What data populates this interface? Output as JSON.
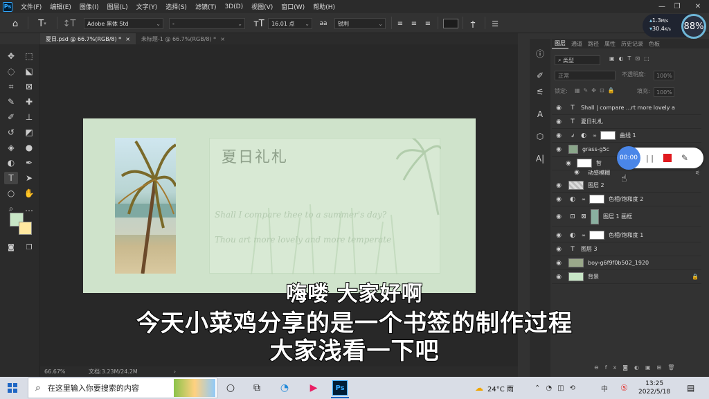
{
  "app": {
    "logo": "Ps",
    "menu": [
      "文件(F)",
      "编辑(E)",
      "图像(I)",
      "图层(L)",
      "文字(Y)",
      "选择(S)",
      "滤镜(T)",
      "3D(D)",
      "视图(V)",
      "窗口(W)",
      "帮助(H)"
    ]
  },
  "options": {
    "font_family": "Adobe 黑体 Std",
    "font_style": "-",
    "font_size": "16.01 点",
    "antialias_icon": "aa",
    "antialias": "锐利"
  },
  "perf_widget": {
    "upload": "1.3",
    "upload_unit": "M/s",
    "download": "30.4",
    "download_unit": "K/s",
    "percent": "88%"
  },
  "tabs": [
    {
      "label": "夏日.psd @ 66.7%(RGB/8) *",
      "close": "×"
    },
    {
      "label": "未标题-1 @ 66.7%(RGB/8) *",
      "close": "×"
    }
  ],
  "canvas": {
    "title": "夏日礼札",
    "script_line1": "Shall I compare thee to a summer's day?",
    "script_line2": "Thou art more lovely and more temperate"
  },
  "status": {
    "zoom": "66.67%",
    "doc": "文档:3.23M/24.2M",
    "arrow": "›"
  },
  "panel": {
    "tabs": [
      "图层",
      "通道",
      "路径",
      "属性",
      "历史记录",
      "色板"
    ],
    "filter": "类型",
    "blend": "正常",
    "opacity_label": "不透明度:",
    "opacity": "100%",
    "lock_label": "锁定:",
    "fill_label": "填充:",
    "fill": "100%",
    "layers": [
      {
        "type": "T",
        "name": "Shall | compare ...rt more lovely a"
      },
      {
        "type": "T",
        "name": "夏日礼札"
      },
      {
        "type": "adj",
        "name": "曲线 1"
      },
      {
        "type": "smart",
        "name": "grass-g5c"
      },
      {
        "type": "sub",
        "name": "智"
      },
      {
        "type": "fx",
        "name": "动感模糊"
      },
      {
        "type": "pixel",
        "name": "图层 2"
      },
      {
        "type": "adj",
        "name": "色相/饱和度 2"
      },
      {
        "type": "frame",
        "name": "图层 1 画框"
      },
      {
        "type": "adj",
        "name": "色相/饱和度 1"
      },
      {
        "type": "T",
        "name": "图层 3"
      },
      {
        "type": "pixel",
        "name": "boy-g6f9f0b502_1920"
      },
      {
        "type": "bg",
        "name": "背景"
      }
    ]
  },
  "recorder": {
    "time": "00:00",
    "pause": "| |"
  },
  "subtitles": [
    "嗨喽 大家好啊",
    "今天小菜鸡分享的是一个书签的制作过程",
    "大家浅看一下吧"
  ],
  "taskbar": {
    "search_placeholder": "在这里输入你要搜索的内容",
    "weather": "24°C 雨",
    "ime": "中",
    "time": "13:25",
    "date": "2022/5/18"
  },
  "colors": {
    "foreground": "#c8e6c6",
    "background": "#ffe8a0",
    "artboard": "#cfe3cb",
    "recorder_blue": "#4a86e8",
    "recorder_red": "#e0191e"
  }
}
